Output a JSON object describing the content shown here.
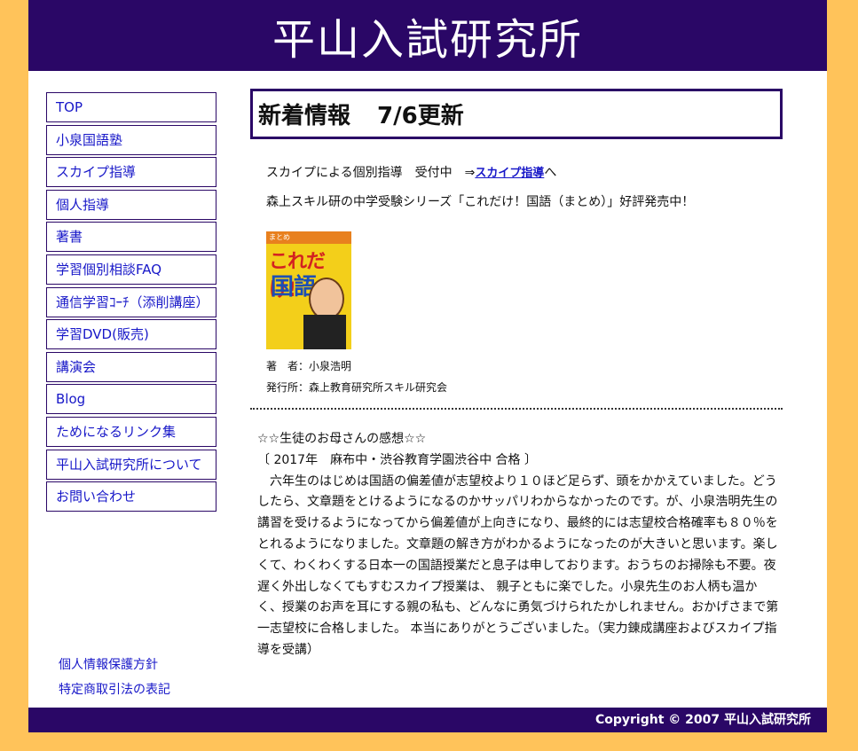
{
  "header": {
    "title": "平山入試研究所"
  },
  "nav": {
    "items": [
      "TOP",
      "小泉国語塾",
      "スカイプ指導",
      "個人指導",
      "著書",
      "学習個別相談FAQ",
      "通信学習ｺｰﾁ（添削講座）",
      "学習DVD(販売)",
      "講演会",
      "Blog",
      "ためになるリンク集",
      "平山入試研究所について",
      "お問い合わせ"
    ]
  },
  "side_links": [
    "個人情報保護方針",
    "特定商取引法の表記"
  ],
  "main": {
    "title": "新着情報",
    "update": "7/6更新",
    "skype_notice": "スカイプによる個別指導　受付中　⇒",
    "skype_link": "スカイプ指導",
    "skype_suffix": "へ",
    "book_notice": "森上スキル研の中学受験シリーズ「これだけ！国語（まとめ）」好評発売中！",
    "book": {
      "cover_top": "まとめ",
      "cover_main": "これだけ!",
      "cover_sub": "国語",
      "author": "著　者：小泉浩明",
      "publisher": "発行所：森上教育研究所スキル研究会"
    },
    "testimonial": {
      "heading": "☆☆生徒のお母さんの感想☆☆",
      "school": "〔 2017年　麻布中・渋谷教育学園渋谷中 合格 〕",
      "body": "　六年生のはじめは国語の偏差値が志望校より１０ほど足らず、頭をかかえていました。どうしたら、文章題をとけるようになるのかサッパリわからなかったのです。が、小泉浩明先生の講習を受けるようになってから偏差値が上向きになり、最終的には志望校合格確率も８０％をとれるようになりました。文章題の解き方がわかるようになったのが大きいと思います。楽しくて、わくわくする日本一の国語授業だと息子は申しております。おうちのお掃除も不要。夜遅く外出しなくてもすむスカイプ授業は、 親子ともに楽でした。小泉先生のお人柄も温かく、授業のお声を耳にする親の私も、どんなに勇気づけられたかしれません。おかげさまで第一志望校に合格しました。 本当にありがとうございました。（実力錬成講座およびスカイプ指導を受講）"
    }
  },
  "footer": {
    "copyright": "Copyright © 2007 平山入試研究所"
  },
  "colors": {
    "brand": "#2a0766",
    "background": "#ffc35a",
    "link": "#1717c8"
  }
}
